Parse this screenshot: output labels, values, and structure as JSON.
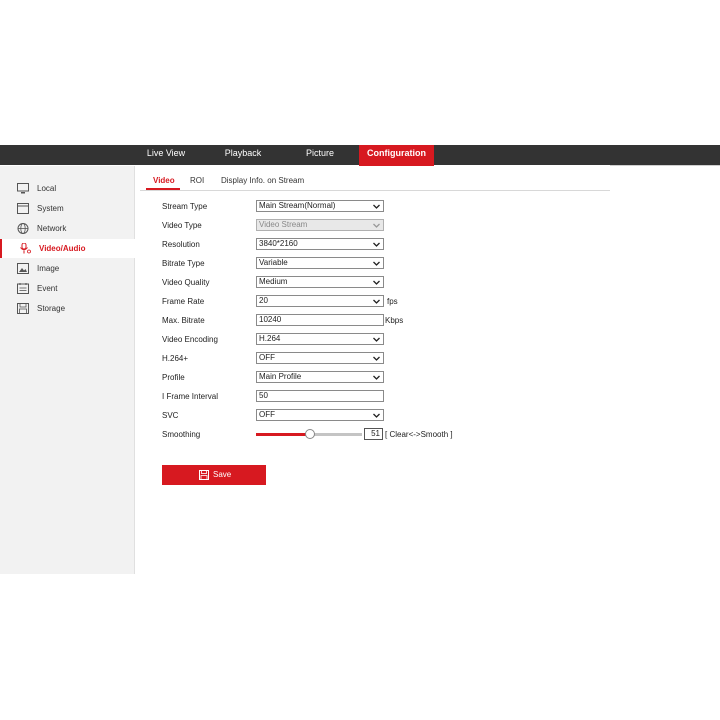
{
  "nav": {
    "live_view": "Live View",
    "playback": "Playback",
    "picture": "Picture",
    "configuration": "Configuration"
  },
  "sidebar": {
    "items": [
      {
        "label": "Local",
        "icon": "monitor-icon"
      },
      {
        "label": "System",
        "icon": "window-icon"
      },
      {
        "label": "Network",
        "icon": "globe-icon"
      },
      {
        "label": "Video/Audio",
        "icon": "microphone-icon"
      },
      {
        "label": "Image",
        "icon": "image-icon"
      },
      {
        "label": "Event",
        "icon": "calendar-icon"
      },
      {
        "label": "Storage",
        "icon": "floppy-icon"
      }
    ],
    "active_index": 3
  },
  "tabs": [
    {
      "label": "Video"
    },
    {
      "label": "ROI"
    },
    {
      "label": "Display Info. on Stream"
    }
  ],
  "form": {
    "stream_type": {
      "label": "Stream Type",
      "value": "Main Stream(Normal)"
    },
    "video_type": {
      "label": "Video Type",
      "value": "Video Stream"
    },
    "resolution": {
      "label": "Resolution",
      "value": "3840*2160"
    },
    "bitrate_type": {
      "label": "Bitrate Type",
      "value": "Variable"
    },
    "video_quality": {
      "label": "Video Quality",
      "value": "Medium"
    },
    "frame_rate": {
      "label": "Frame Rate",
      "value": "20",
      "unit": "fps"
    },
    "max_bitrate": {
      "label": "Max. Bitrate",
      "value": "10240",
      "unit": "Kbps"
    },
    "video_encoding": {
      "label": "Video Encoding",
      "value": "H.264"
    },
    "h264plus": {
      "label": "H.264+",
      "value": "OFF"
    },
    "profile": {
      "label": "Profile",
      "value": "Main Profile"
    },
    "i_frame_interval": {
      "label": "I Frame Interval",
      "value": "50"
    },
    "svc": {
      "label": "SVC",
      "value": "OFF"
    },
    "smoothing": {
      "label": "Smoothing",
      "value": "51",
      "fraction": 0.51,
      "hint": "[ Clear<->Smooth ]"
    }
  },
  "save_label": "Save",
  "colors": {
    "accent": "#d71920",
    "topbar": "#333333",
    "sidebar": "#f2f2f2"
  }
}
